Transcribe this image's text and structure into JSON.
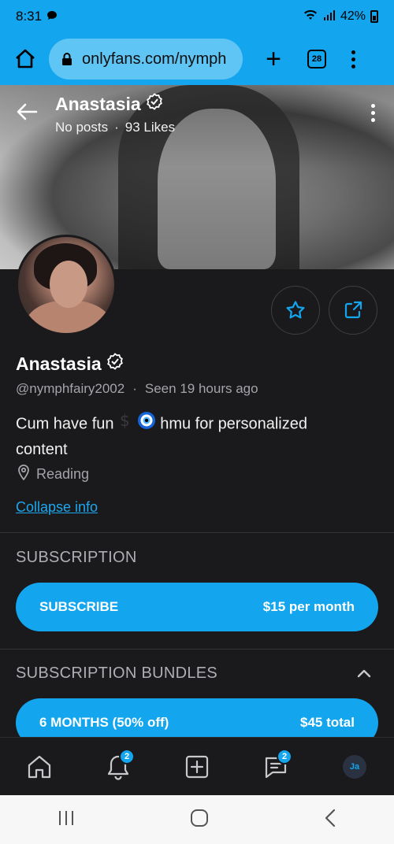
{
  "status_bar": {
    "time": "8:31",
    "battery": "42%"
  },
  "browser": {
    "url": "onlyfans.com/nymph",
    "tab_count": "28"
  },
  "cover": {
    "name": "Anastasia",
    "posts": "No posts",
    "likes": "93 Likes"
  },
  "profile": {
    "name": "Anastasia",
    "handle": "@nymphfairy2002",
    "last_seen": "Seen 19 hours ago",
    "bio_part1": "Cum have fun",
    "bio_part2": "hmu for personalized content",
    "location": "Reading",
    "collapse_label": "Collapse info"
  },
  "subscription": {
    "title": "SUBSCRIPTION",
    "button_label": "SUBSCRIBE",
    "price": "$15 per month"
  },
  "bundles": {
    "title": "SUBSCRIPTION BUNDLES",
    "first_label": "6 MONTHS (50% off)",
    "first_price": "$45 total"
  },
  "bottom_nav": {
    "notifications_badge": "2",
    "messages_badge": "2",
    "user_initials": "Ja"
  },
  "colors": {
    "accent": "#13a6ee",
    "background": "#1a1a1c",
    "muted_text": "#a4a4aa"
  }
}
